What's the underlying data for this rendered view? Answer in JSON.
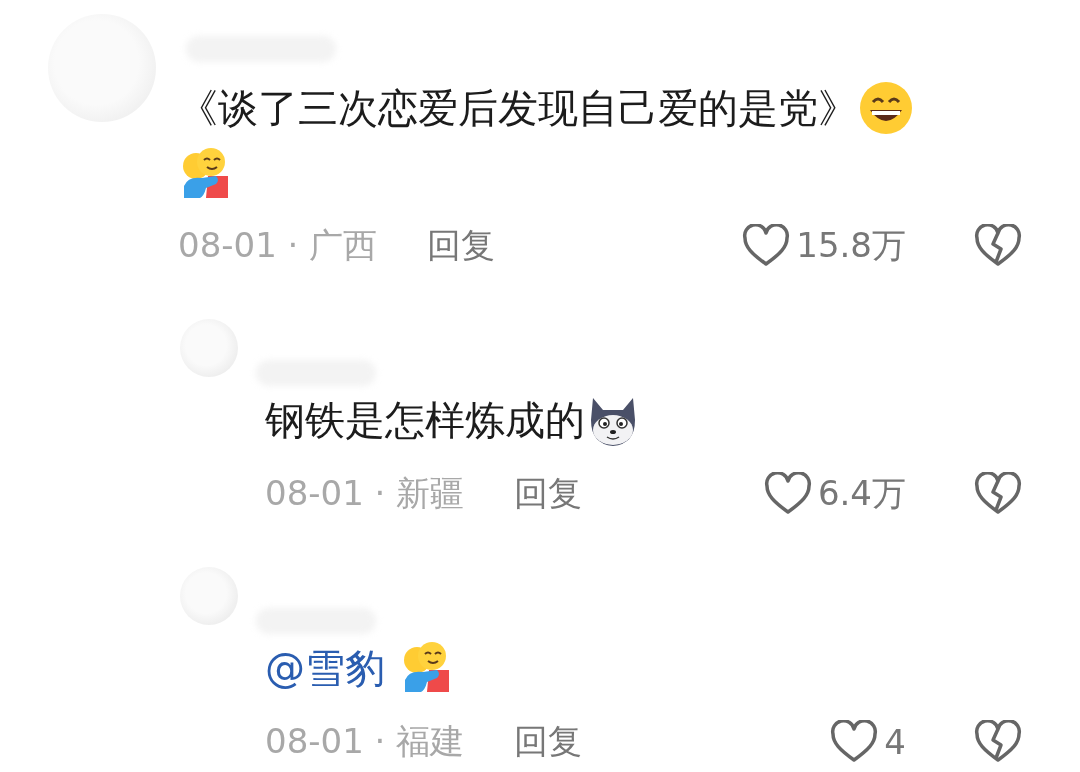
{
  "comments": [
    {
      "text": "《谈了三次恋爱后发现自己爱的是党》",
      "emojis": [
        {
          "kind": "grin"
        },
        {
          "kind": "hug"
        }
      ],
      "date": "08-01",
      "separator": "·",
      "location": "广西",
      "reply_label": "回复",
      "likes": "15.8万",
      "children": [
        {
          "text": "钢铁是怎样炼成的",
          "emojis": [
            {
              "kind": "husky"
            }
          ],
          "date": "08-01",
          "separator": "·",
          "location": "新疆",
          "reply_label": "回复",
          "likes": "6.4万"
        },
        {
          "mention": "@雪豹",
          "emojis": [
            {
              "kind": "hug"
            }
          ],
          "date": "08-01",
          "separator": "·",
          "location": "福建",
          "reply_label": "回复",
          "likes": "4"
        }
      ]
    }
  ]
}
